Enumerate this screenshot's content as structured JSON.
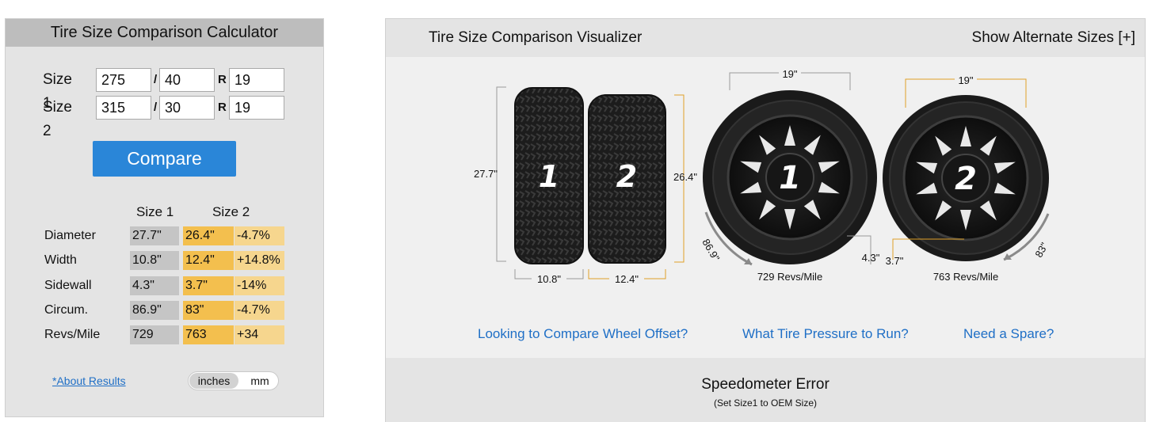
{
  "calculator": {
    "title": "Tire Size Comparison Calculator",
    "size1": {
      "label": "Size 1",
      "width": "275",
      "aspect": "40",
      "rim": "19"
    },
    "size2": {
      "label": "Size 2",
      "width": "315",
      "aspect": "30",
      "rim": "19"
    },
    "separator_slash": "/",
    "separator_r": "R",
    "compare_label": "Compare",
    "results": {
      "col_size1": "Size 1",
      "col_size2": "Size 2",
      "rows": [
        {
          "label": "Diameter",
          "size1": "27.7\"",
          "size2": "26.4\"",
          "diff": "-4.7%"
        },
        {
          "label": "Width",
          "size1": "10.8\"",
          "size2": "12.4\"",
          "diff": "+14.8%"
        },
        {
          "label": "Sidewall",
          "size1": "4.3\"",
          "size2": "3.7\"",
          "diff": "-14%"
        },
        {
          "label": "Circum.",
          "size1": "86.9\"",
          "size2": "83\"",
          "diff": "-4.7%"
        },
        {
          "label": "Revs/Mile",
          "size1": "729",
          "size2": "763",
          "diff": "+34"
        }
      ]
    },
    "about_link": "*About Results",
    "units": {
      "active": "inches",
      "inactive": "mm"
    }
  },
  "visualizer": {
    "title": "Tire Size Comparison Visualizer",
    "alternate_sizes": "Show Alternate Sizes [+]",
    "tire1": {
      "number": "1",
      "diameter": "27.7\"",
      "width": "10.8\"",
      "rim": "19\"",
      "sidewall": "4.3\"",
      "circumference": "86.9\"",
      "revs": "729 Revs/Mile"
    },
    "tire2": {
      "number": "2",
      "diameter": "26.4\"",
      "width": "12.4\"",
      "rim": "19\"",
      "sidewall": "3.7\"",
      "circumference": "83\"",
      "revs": "763 Revs/Mile"
    },
    "links": {
      "wheel_offset": "Looking to Compare Wheel Offset?",
      "tire_pressure": "What Tire Pressure to Run?",
      "spare": "Need a Spare?"
    },
    "speedometer": {
      "title": "Speedometer Error",
      "subtitle": "(Set Size1 to OEM Size)"
    }
  },
  "colors": {
    "accent_blue": "#2a86d8",
    "size1_gray": "#c5c5c5",
    "size2_orange": "#f3bf4e",
    "diff_light": "#f6d68e",
    "dim_line_orange": "#e0a128"
  }
}
